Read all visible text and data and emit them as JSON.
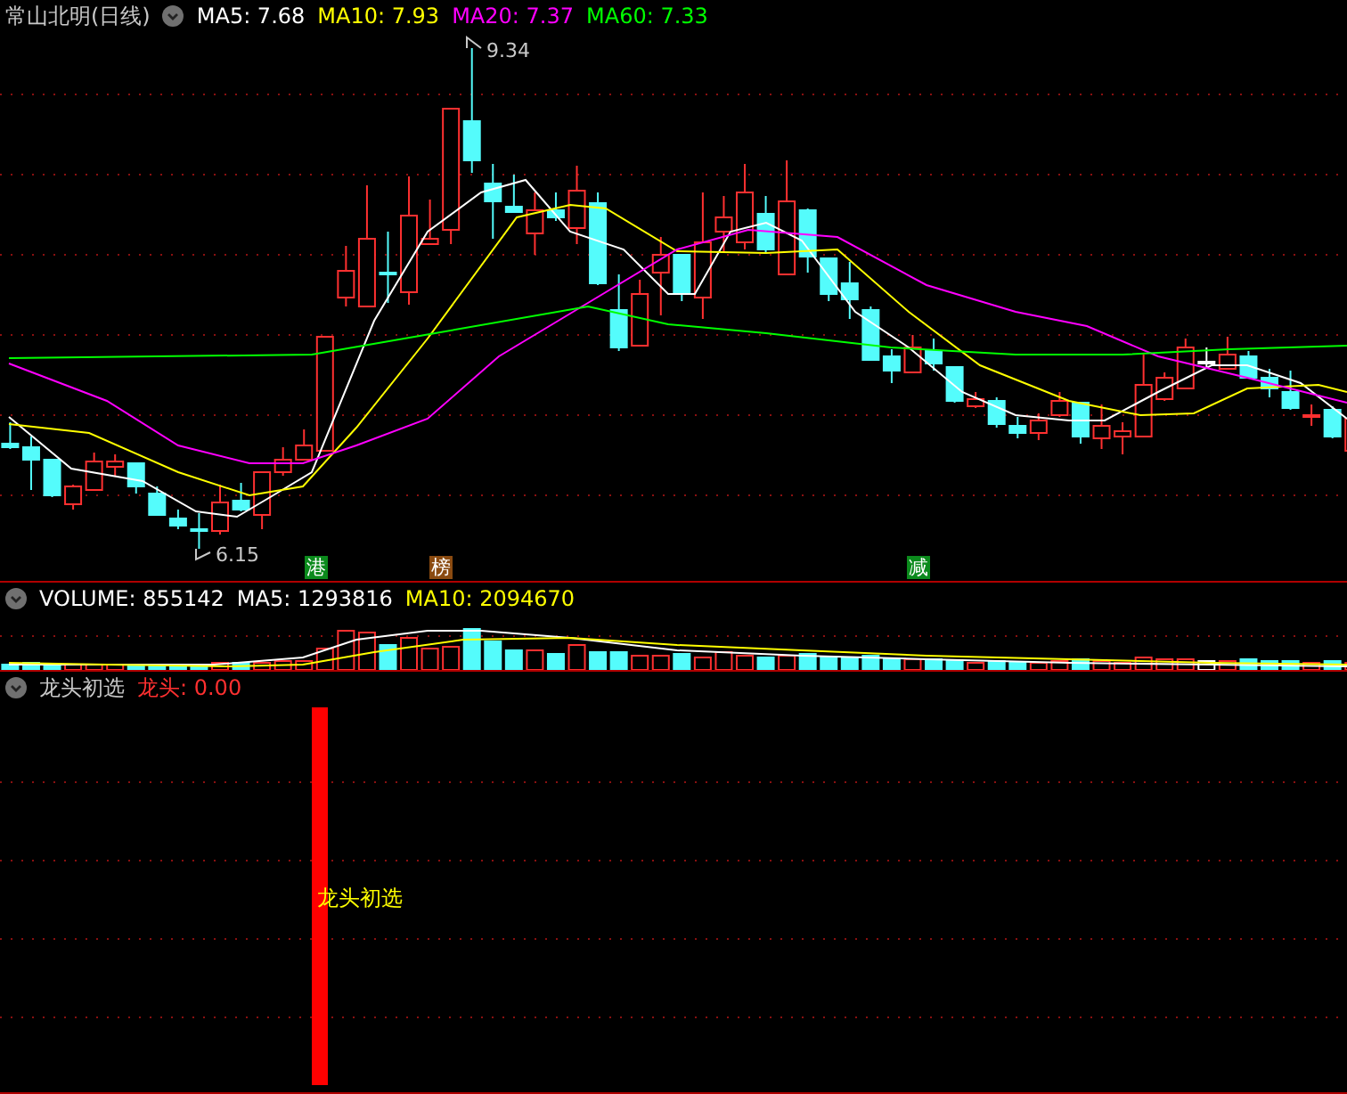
{
  "header": {
    "title": "常山北明(日线)",
    "legend": [
      {
        "text": "MA5: 7.68",
        "color": "#ffffff"
      },
      {
        "text": "MA10: 7.93",
        "color": "#ffff00"
      },
      {
        "text": "MA20: 7.37",
        "color": "#ff00ff"
      },
      {
        "text": "MA60: 7.33",
        "color": "#00ff00"
      }
    ]
  },
  "price_labels": {
    "high": "9.34",
    "low": "6.15"
  },
  "signals": [
    {
      "text": "港",
      "color": "#0b8a1c"
    },
    {
      "text": "榜",
      "color": "#8a4a10"
    },
    {
      "text": "减",
      "color": "#0b8a1c"
    }
  ],
  "volume": {
    "legend": [
      {
        "text": "VOLUME: 855142",
        "color": "#ffffff"
      },
      {
        "text": "MA5: 1293816",
        "color": "#ffffff"
      },
      {
        "text": "MA10: 2094670",
        "color": "#ffff00"
      }
    ]
  },
  "indicator": {
    "title": "龙头初选",
    "value": "龙头: 0.00",
    "bar_label": "龙头初选"
  }
}
